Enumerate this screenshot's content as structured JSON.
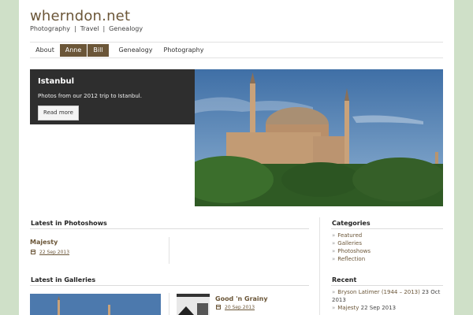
{
  "site": {
    "title": "wherndon.net",
    "tagline": [
      "Photography",
      "Travel",
      "Genealogy"
    ],
    "tagline_separator": "|"
  },
  "nav": {
    "items": [
      {
        "label": "About",
        "active": false
      },
      {
        "label": "Anne",
        "active": true
      },
      {
        "label": "Bill",
        "active": true
      },
      {
        "label": "Genealogy",
        "active": false
      },
      {
        "label": "Photography",
        "active": false
      }
    ]
  },
  "feature": {
    "title": "Istanbul",
    "description": "Photos from our 2012 trip to Istanbul.",
    "button": "Read more",
    "image_icon": "hagia-sophia-photo"
  },
  "photoshows": {
    "heading": "Latest in Photoshows",
    "posts": [
      {
        "title": "Majesty",
        "date": "22 Sep 2013"
      }
    ]
  },
  "galleries": {
    "heading": "Latest in Galleries",
    "posts": [
      {
        "title": "Good 'n Grainy",
        "date": "20 Sep 2013"
      }
    ]
  },
  "categories": {
    "heading": "Categories",
    "items": [
      "Featured",
      "Galleries",
      "Photoshows",
      "Reflection"
    ]
  },
  "recent": {
    "heading": "Recent",
    "items": [
      {
        "title": "Bryson Latimer (1944 – 2013)",
        "date": "23 Oct 2013"
      },
      {
        "title": "Majesty",
        "date": "22 Sep 2013"
      }
    ]
  },
  "colors": {
    "accent": "#6b5638",
    "background": "#cfe0c8",
    "feature_box": "#2e2e2e"
  }
}
